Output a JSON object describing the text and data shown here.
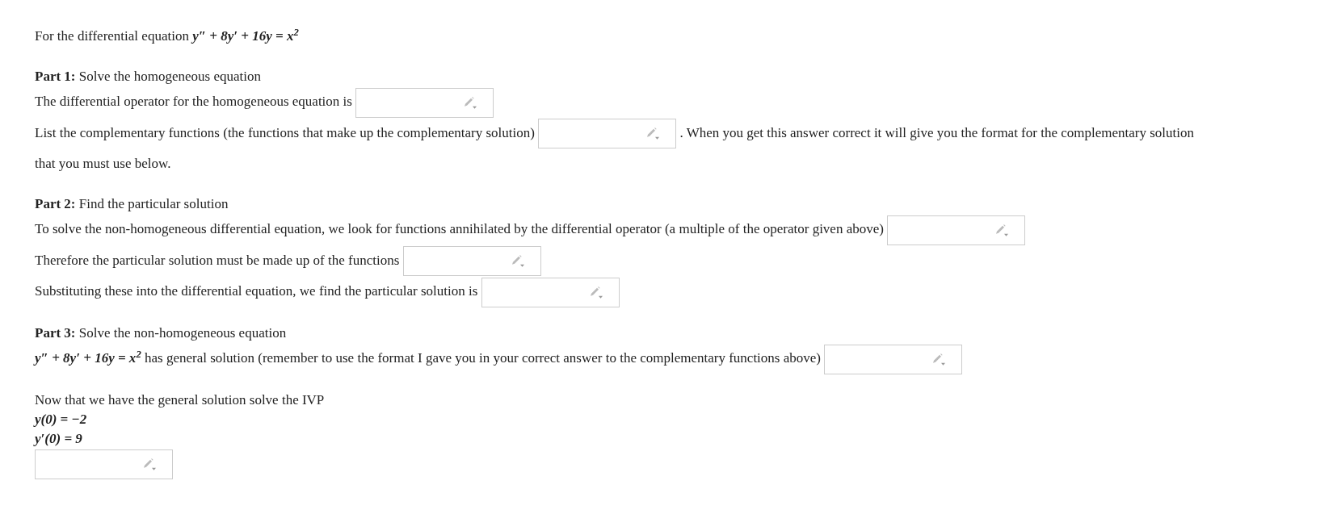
{
  "intro": [
    {
      "kind": "text",
      "text": "For the differential equation"
    },
    {
      "kind": "math",
      "text": "y″ + 8y′ + 16y = x$^{2}$"
    }
  ],
  "sections": [
    {
      "heading": "**Part 1:** Solve the homogeneous equation",
      "lines": [
        [
          {
            "kind": "text",
            "text": "The differential operator for the homogeneous equation is"
          },
          {
            "kind": "field"
          }
        ],
        [
          {
            "kind": "text",
            "text": "List the complementary functions (the functions that make up the complementary solution)"
          },
          {
            "kind": "field"
          },
          {
            "kind": "text",
            "text": ". When you get this answer correct it will give you the format for the complementary solution"
          }
        ],
        [
          {
            "kind": "text",
            "text": "that you must use below."
          }
        ]
      ]
    },
    {
      "heading": "**Part 2:** Find the particular solution",
      "lines": [
        [
          {
            "kind": "text",
            "text": "To solve the non-homogeneous differential equation, we look for functions annihilated by the differential operator (a multiple of the operator given above)"
          },
          {
            "kind": "field"
          }
        ],
        [
          {
            "kind": "text",
            "text": "Therefore the particular solution must be made up of the functions"
          },
          {
            "kind": "field"
          }
        ],
        [
          {
            "kind": "text",
            "text": "Substituting these into the differential equation, we find the particular solution is"
          },
          {
            "kind": "field"
          }
        ]
      ]
    },
    {
      "heading": "**Part 3:** Solve the non-homogeneous equation",
      "lines": [
        [
          {
            "kind": "math",
            "text": "y″ + 8y′ + 16y = x$^{2}$"
          },
          {
            "kind": "text",
            "text": "has general solution (remember to use the format I gave you in your correct answer to the complementary functions above)"
          },
          {
            "kind": "field"
          }
        ]
      ]
    },
    {
      "heading": "Now that we have the general solution solve the IVP",
      "lines": [
        [
          {
            "kind": "math",
            "text": "y(0) = −2"
          }
        ],
        [
          {
            "kind": "math",
            "text": "y′(0) = 9"
          }
        ],
        [
          {
            "kind": "field"
          }
        ]
      ]
    }
  ]
}
